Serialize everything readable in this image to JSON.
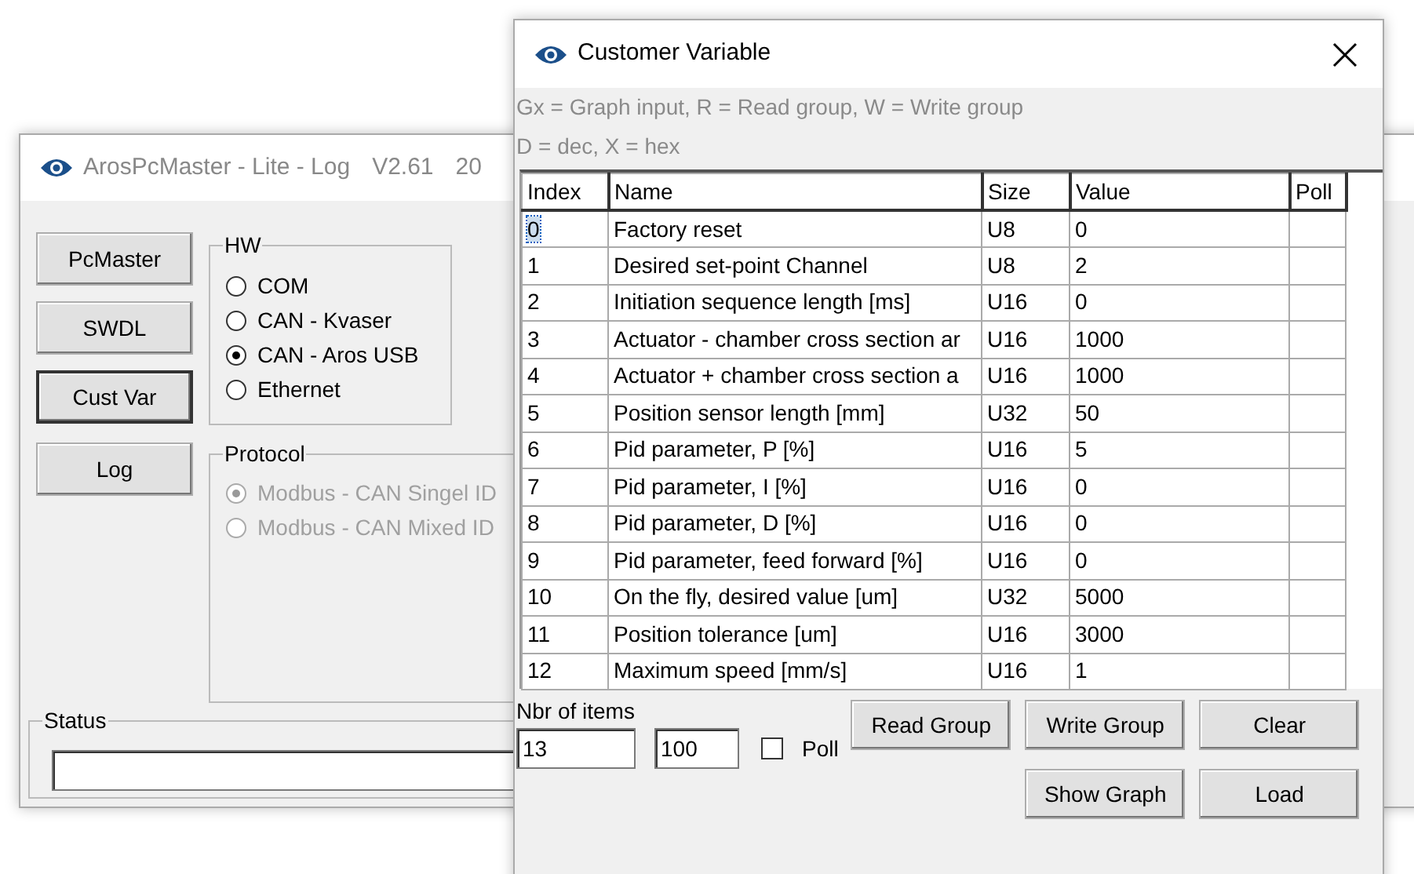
{
  "back_window": {
    "title": "ArosPcMaster - Lite - Log",
    "version": "V2.61",
    "title_cut": "20",
    "buttons": [
      {
        "label": "PcMaster",
        "default": false
      },
      {
        "label": "SWDL",
        "default": false
      },
      {
        "label": "Cust Var",
        "default": true
      },
      {
        "label": "Log",
        "default": false
      }
    ],
    "hw_group": {
      "title": "HW",
      "options": [
        {
          "label": "COM",
          "selected": false
        },
        {
          "label": "CAN - Kvaser",
          "selected": false
        },
        {
          "label": "CAN - Aros USB",
          "selected": true
        },
        {
          "label": "Ethernet",
          "selected": false
        }
      ]
    },
    "protocol_group": {
      "title": "Protocol",
      "disabled": true,
      "options": [
        {
          "label": "Modbus - CAN Singel ID",
          "selected": true
        },
        {
          "label": "Modbus - CAN Mixed ID",
          "selected": false
        }
      ]
    },
    "status_group": {
      "title": "Status"
    }
  },
  "dialog": {
    "title": "Customer Variable",
    "hint_lines": [
      "Gx = Graph input, R = Read group, W = Write group",
      "D = dec, X = hex"
    ],
    "table": {
      "columns": [
        "Index",
        "Name",
        "Size",
        "Value",
        "Poll"
      ],
      "rows": [
        {
          "index": "0",
          "name": "Factory reset",
          "size": "U8",
          "value": "0",
          "selected": true
        },
        {
          "index": "1",
          "name": "Desired set-point Channel",
          "size": "U8",
          "value": "2",
          "selected": false
        },
        {
          "index": "2",
          "name": "Initiation sequence length [ms]",
          "size": "U16",
          "value": "0",
          "selected": false
        },
        {
          "index": "3",
          "name": "Actuator - chamber cross section ar",
          "size": "U16",
          "value": "1000",
          "selected": false
        },
        {
          "index": "4",
          "name": "Actuator + chamber cross section a",
          "size": "U16",
          "value": "1000",
          "selected": false
        },
        {
          "index": "5",
          "name": "Position sensor length [mm]",
          "size": "U32",
          "value": "50",
          "selected": false
        },
        {
          "index": "6",
          "name": "Pid parameter, P [%]",
          "size": "U16",
          "value": "5",
          "selected": false
        },
        {
          "index": "7",
          "name": "Pid parameter, I [%]",
          "size": "U16",
          "value": "0",
          "selected": false
        },
        {
          "index": "8",
          "name": "Pid parameter, D [%]",
          "size": "U16",
          "value": "0",
          "selected": false
        },
        {
          "index": "9",
          "name": "Pid parameter, feed forward [%]",
          "size": "U16",
          "value": "0",
          "selected": false
        },
        {
          "index": "10",
          "name": "On the fly, desired value [um]",
          "size": "U32",
          "value": "5000",
          "selected": false
        },
        {
          "index": "11",
          "name": "Position tolerance [um]",
          "size": "U16",
          "value": "3000",
          "selected": false
        },
        {
          "index": "12",
          "name": "Maximum speed [mm/s]",
          "size": "U16",
          "value": "1",
          "selected": false
        }
      ]
    },
    "nbr_label": "Nbr of items",
    "nbr_value": "13",
    "interval_value": "100",
    "poll": {
      "label": "Poll",
      "checked": false
    },
    "buttons_row1": [
      "Read Group",
      "Write Group",
      "Clear"
    ],
    "buttons_row2": [
      "Show Graph",
      "Load"
    ]
  }
}
